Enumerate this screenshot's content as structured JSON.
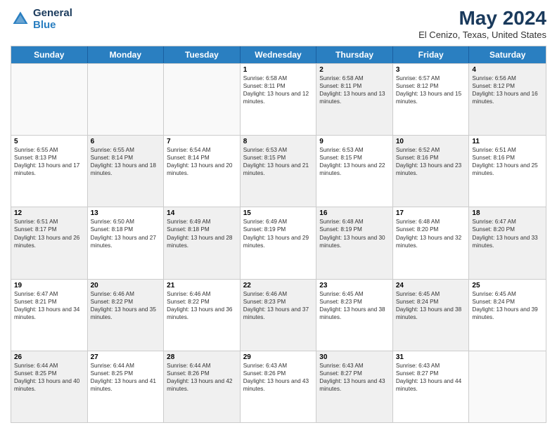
{
  "header": {
    "logo_line1": "General",
    "logo_line2": "Blue",
    "month_title": "May 2024",
    "location": "El Cenizo, Texas, United States"
  },
  "weekdays": [
    "Sunday",
    "Monday",
    "Tuesday",
    "Wednesday",
    "Thursday",
    "Friday",
    "Saturday"
  ],
  "rows": [
    [
      {
        "day": "",
        "sunrise": "",
        "sunset": "",
        "daylight": "",
        "empty": true
      },
      {
        "day": "",
        "sunrise": "",
        "sunset": "",
        "daylight": "",
        "empty": true
      },
      {
        "day": "",
        "sunrise": "",
        "sunset": "",
        "daylight": "",
        "empty": true
      },
      {
        "day": "1",
        "sunrise": "Sunrise: 6:58 AM",
        "sunset": "Sunset: 8:11 PM",
        "daylight": "Daylight: 13 hours and 12 minutes."
      },
      {
        "day": "2",
        "sunrise": "Sunrise: 6:58 AM",
        "sunset": "Sunset: 8:11 PM",
        "daylight": "Daylight: 13 hours and 13 minutes."
      },
      {
        "day": "3",
        "sunrise": "Sunrise: 6:57 AM",
        "sunset": "Sunset: 8:12 PM",
        "daylight": "Daylight: 13 hours and 15 minutes."
      },
      {
        "day": "4",
        "sunrise": "Sunrise: 6:56 AM",
        "sunset": "Sunset: 8:12 PM",
        "daylight": "Daylight: 13 hours and 16 minutes."
      }
    ],
    [
      {
        "day": "5",
        "sunrise": "Sunrise: 6:55 AM",
        "sunset": "Sunset: 8:13 PM",
        "daylight": "Daylight: 13 hours and 17 minutes."
      },
      {
        "day": "6",
        "sunrise": "Sunrise: 6:55 AM",
        "sunset": "Sunset: 8:14 PM",
        "daylight": "Daylight: 13 hours and 18 minutes."
      },
      {
        "day": "7",
        "sunrise": "Sunrise: 6:54 AM",
        "sunset": "Sunset: 8:14 PM",
        "daylight": "Daylight: 13 hours and 20 minutes."
      },
      {
        "day": "8",
        "sunrise": "Sunrise: 6:53 AM",
        "sunset": "Sunset: 8:15 PM",
        "daylight": "Daylight: 13 hours and 21 minutes."
      },
      {
        "day": "9",
        "sunrise": "Sunrise: 6:53 AM",
        "sunset": "Sunset: 8:15 PM",
        "daylight": "Daylight: 13 hours and 22 minutes."
      },
      {
        "day": "10",
        "sunrise": "Sunrise: 6:52 AM",
        "sunset": "Sunset: 8:16 PM",
        "daylight": "Daylight: 13 hours and 23 minutes."
      },
      {
        "day": "11",
        "sunrise": "Sunrise: 6:51 AM",
        "sunset": "Sunset: 8:16 PM",
        "daylight": "Daylight: 13 hours and 25 minutes."
      }
    ],
    [
      {
        "day": "12",
        "sunrise": "Sunrise: 6:51 AM",
        "sunset": "Sunset: 8:17 PM",
        "daylight": "Daylight: 13 hours and 26 minutes."
      },
      {
        "day": "13",
        "sunrise": "Sunrise: 6:50 AM",
        "sunset": "Sunset: 8:18 PM",
        "daylight": "Daylight: 13 hours and 27 minutes."
      },
      {
        "day": "14",
        "sunrise": "Sunrise: 6:49 AM",
        "sunset": "Sunset: 8:18 PM",
        "daylight": "Daylight: 13 hours and 28 minutes."
      },
      {
        "day": "15",
        "sunrise": "Sunrise: 6:49 AM",
        "sunset": "Sunset: 8:19 PM",
        "daylight": "Daylight: 13 hours and 29 minutes."
      },
      {
        "day": "16",
        "sunrise": "Sunrise: 6:48 AM",
        "sunset": "Sunset: 8:19 PM",
        "daylight": "Daylight: 13 hours and 30 minutes."
      },
      {
        "day": "17",
        "sunrise": "Sunrise: 6:48 AM",
        "sunset": "Sunset: 8:20 PM",
        "daylight": "Daylight: 13 hours and 32 minutes."
      },
      {
        "day": "18",
        "sunrise": "Sunrise: 6:47 AM",
        "sunset": "Sunset: 8:20 PM",
        "daylight": "Daylight: 13 hours and 33 minutes."
      }
    ],
    [
      {
        "day": "19",
        "sunrise": "Sunrise: 6:47 AM",
        "sunset": "Sunset: 8:21 PM",
        "daylight": "Daylight: 13 hours and 34 minutes."
      },
      {
        "day": "20",
        "sunrise": "Sunrise: 6:46 AM",
        "sunset": "Sunset: 8:22 PM",
        "daylight": "Daylight: 13 hours and 35 minutes."
      },
      {
        "day": "21",
        "sunrise": "Sunrise: 6:46 AM",
        "sunset": "Sunset: 8:22 PM",
        "daylight": "Daylight: 13 hours and 36 minutes."
      },
      {
        "day": "22",
        "sunrise": "Sunrise: 6:46 AM",
        "sunset": "Sunset: 8:23 PM",
        "daylight": "Daylight: 13 hours and 37 minutes."
      },
      {
        "day": "23",
        "sunrise": "Sunrise: 6:45 AM",
        "sunset": "Sunset: 8:23 PM",
        "daylight": "Daylight: 13 hours and 38 minutes."
      },
      {
        "day": "24",
        "sunrise": "Sunrise: 6:45 AM",
        "sunset": "Sunset: 8:24 PM",
        "daylight": "Daylight: 13 hours and 38 minutes."
      },
      {
        "day": "25",
        "sunrise": "Sunrise: 6:45 AM",
        "sunset": "Sunset: 8:24 PM",
        "daylight": "Daylight: 13 hours and 39 minutes."
      }
    ],
    [
      {
        "day": "26",
        "sunrise": "Sunrise: 6:44 AM",
        "sunset": "Sunset: 8:25 PM",
        "daylight": "Daylight: 13 hours and 40 minutes."
      },
      {
        "day": "27",
        "sunrise": "Sunrise: 6:44 AM",
        "sunset": "Sunset: 8:25 PM",
        "daylight": "Daylight: 13 hours and 41 minutes."
      },
      {
        "day": "28",
        "sunrise": "Sunrise: 6:44 AM",
        "sunset": "Sunset: 8:26 PM",
        "daylight": "Daylight: 13 hours and 42 minutes."
      },
      {
        "day": "29",
        "sunrise": "Sunrise: 6:43 AM",
        "sunset": "Sunset: 8:26 PM",
        "daylight": "Daylight: 13 hours and 43 minutes."
      },
      {
        "day": "30",
        "sunrise": "Sunrise: 6:43 AM",
        "sunset": "Sunset: 8:27 PM",
        "daylight": "Daylight: 13 hours and 43 minutes."
      },
      {
        "day": "31",
        "sunrise": "Sunrise: 6:43 AM",
        "sunset": "Sunset: 8:27 PM",
        "daylight": "Daylight: 13 hours and 44 minutes."
      },
      {
        "day": "",
        "sunrise": "",
        "sunset": "",
        "daylight": "",
        "empty": true
      }
    ]
  ]
}
